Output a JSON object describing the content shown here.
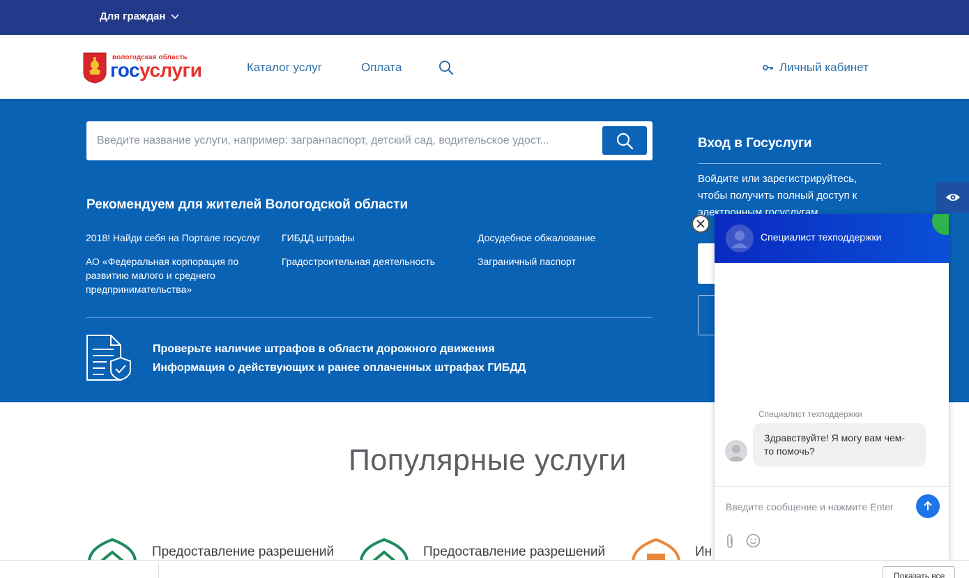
{
  "topbar": {
    "for_citizens": "Для граждан"
  },
  "header": {
    "logo_region": "вологодская область",
    "logo_brand_part1": "гос",
    "logo_brand_part2": "услуги",
    "nav": {
      "catalog": "Каталог услуг",
      "payment": "Оплата"
    },
    "cabinet": "Личный кабинет"
  },
  "hero": {
    "search_placeholder": "Введите название услуги, например: загранпаспорт, детский сад, водительское удост...",
    "recommend_title": "Рекомендуем для жителей Вологодской области",
    "recommend_links": [
      "2018! Найди себя на Портале госуслуг",
      "ГИБДД штрафы",
      "Досудебное обжалование",
      "АО «Федеральная корпорация по развитию малого и среднего предпринимательства»",
      "Градостроительная деятельность",
      "Заграничный паспорт"
    ],
    "fines_line1": "Проверьте наличие штрафов в области дорожного движения",
    "fines_line2": "Информация о действующих и ранее оплаченных штрафах ГИБДД"
  },
  "login": {
    "title": "Вход в Госуслуги",
    "text": "Войдите или зарегистрируйтесь, чтобы получить полный доступ к электронным госуслугам"
  },
  "popular": {
    "title": "Популярные услуги",
    "items": [
      "Предоставление разрешений",
      "Предоставление разрешений",
      "Ин"
    ]
  },
  "chat": {
    "agent_name": "Специалист техподдержки",
    "message_author": "Специалист техподдержки",
    "message_text": "Здравствуйте! Я могу вам чем-то помочь?",
    "input_placeholder": "Введите сообщение и нажмите Enter"
  },
  "download_bar": {
    "show_all": "Показать все"
  },
  "colors": {
    "topbar": "#233a8b",
    "hero": "#0a62b5",
    "link": "#2f6fa8",
    "brand_red": "#e4332b",
    "chat_header": "#0a2ac0",
    "popular_green": "#1f8a5a",
    "popular_orange": "#e8873a"
  }
}
